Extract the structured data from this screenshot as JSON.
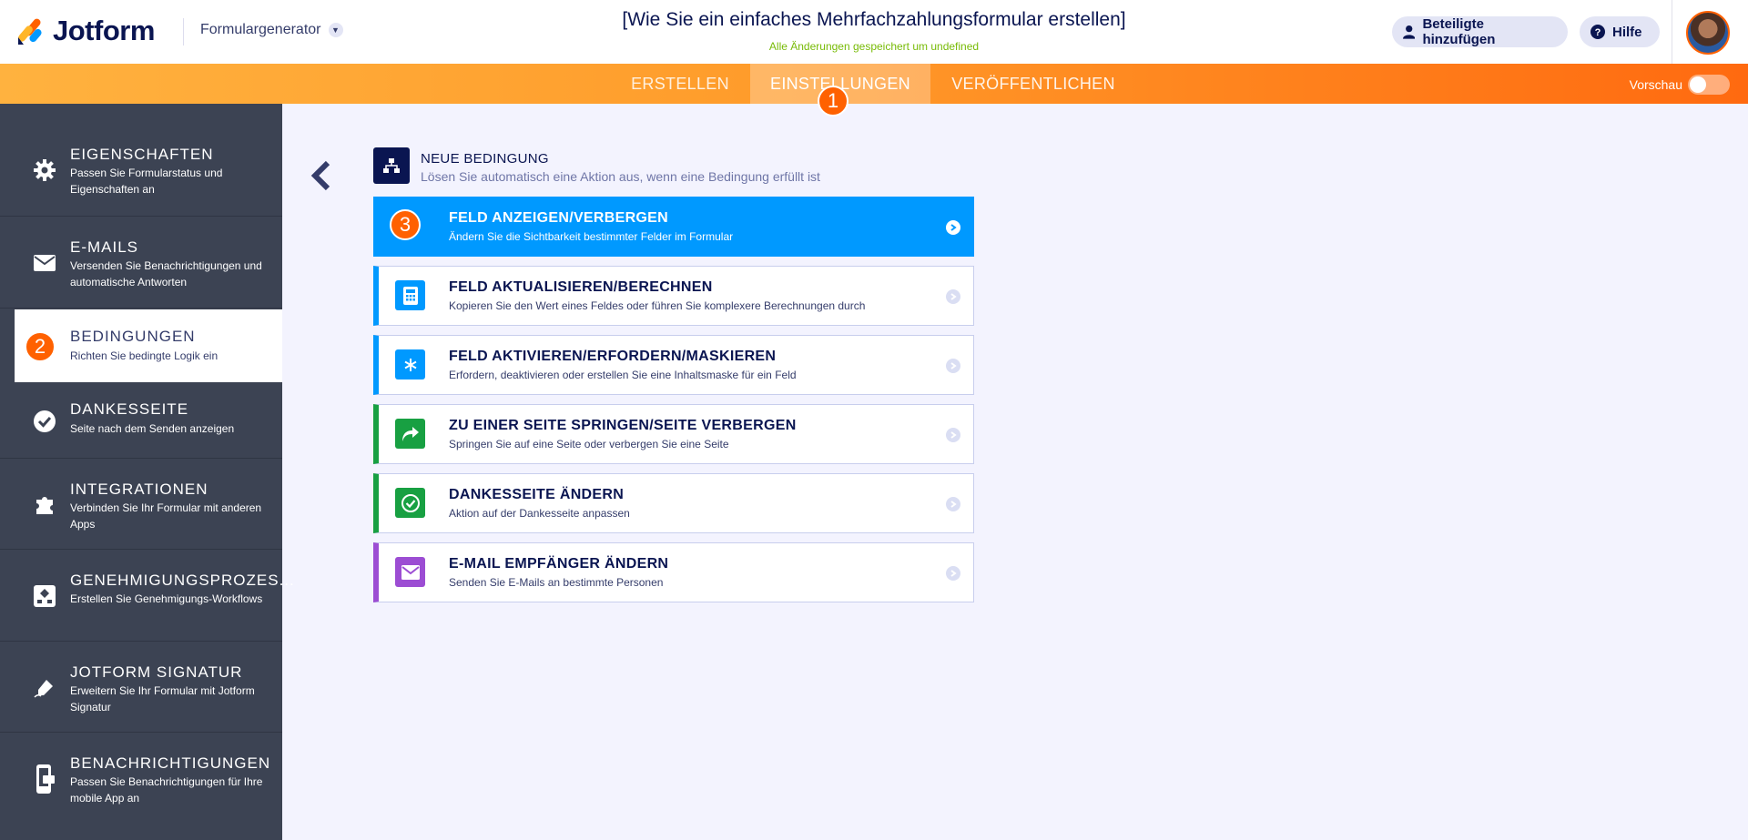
{
  "header": {
    "logo_text": "Jotform",
    "form_builder_label": "Formulargenerator",
    "form_title": "[Wie Sie ein einfaches Mehrfachzahlungsformular erstellen]",
    "saved_note": "Alle Änderungen gespeichert um undefined",
    "add_participants_label": "Beteiligte hinzufügen",
    "help_label": "Hilfe"
  },
  "tabs": {
    "create": "ERSTELLEN",
    "settings": "EINSTELLUNGEN",
    "publish": "VERÖFFENTLICHEN",
    "preview_label": "Vorschau"
  },
  "badges": {
    "one": "1",
    "two": "2",
    "three": "3"
  },
  "sidebar": {
    "items": [
      {
        "title": "EIGENSCHAFTEN",
        "desc": "Passen Sie Formularstatus und Eigenschaften an"
      },
      {
        "title": "E-MAILS",
        "desc": "Versenden Sie Benachrichtigungen und automatische Antworten"
      },
      {
        "title": "BEDINGUNGEN",
        "desc": "Richten Sie bedingte Logik ein"
      },
      {
        "title": "DANKESSEITE",
        "desc": "Seite nach dem Senden anzeigen"
      },
      {
        "title": "INTEGRATIONEN",
        "desc": "Verbinden Sie Ihr Formular mit anderen Apps"
      },
      {
        "title": "GENEHMIGUNGSPROZES...",
        "desc": "Erstellen Sie Genehmigungs-Workflows"
      },
      {
        "title": "JOTFORM SIGNATUR",
        "desc": "Erweitern Sie Ihr Formular mit Jotform Signatur"
      },
      {
        "title": "BENACHRICHTIGUNGEN",
        "desc": "Passen Sie Benachrichtigungen für Ihre mobile App an"
      }
    ]
  },
  "main": {
    "new_condition_title": "NEUE BEDINGUNG",
    "new_condition_sub": "Lösen Sie automatisch eine Aktion aus, wenn eine Bedingung erfüllt ist",
    "cards": [
      {
        "title": "FELD ANZEIGEN/VERBERGEN",
        "desc": "Ändern Sie die Sichtbarkeit bestimmter Felder im Formular",
        "color": "#0099ff"
      },
      {
        "title": "FELD AKTUALISIEREN/BERECHNEN",
        "desc": "Kopieren Sie den Wert eines Feldes oder führen Sie komplexere Berechnungen durch",
        "color": "#0099ff"
      },
      {
        "title": "FELD AKTIVIEREN/ERFORDERN/MASKIEREN",
        "desc": "Erfordern, deaktivieren oder erstellen Sie eine Inhaltsmaske für ein Feld",
        "color": "#0099ff"
      },
      {
        "title": "ZU EINER SEITE SPRINGEN/SEITE VERBERGEN",
        "desc": "Springen Sie auf eine Seite oder verbergen Sie eine Seite",
        "color": "#18a042"
      },
      {
        "title": "DANKESSEITE ÄNDERN",
        "desc": "Aktion auf der Dankesseite anpassen",
        "color": "#18a042"
      },
      {
        "title": "E-MAIL EMPFÄNGER ÄNDERN",
        "desc": "Senden Sie E-Mails an bestimmte Personen",
        "color": "#9c4dd3"
      }
    ]
  },
  "colors": {
    "accent_orange": "#ff6100",
    "navy": "#0a1551",
    "blue": "#0099ff",
    "green": "#18a042",
    "purple": "#9c4dd3",
    "sidebar_bg": "#3c4353"
  }
}
